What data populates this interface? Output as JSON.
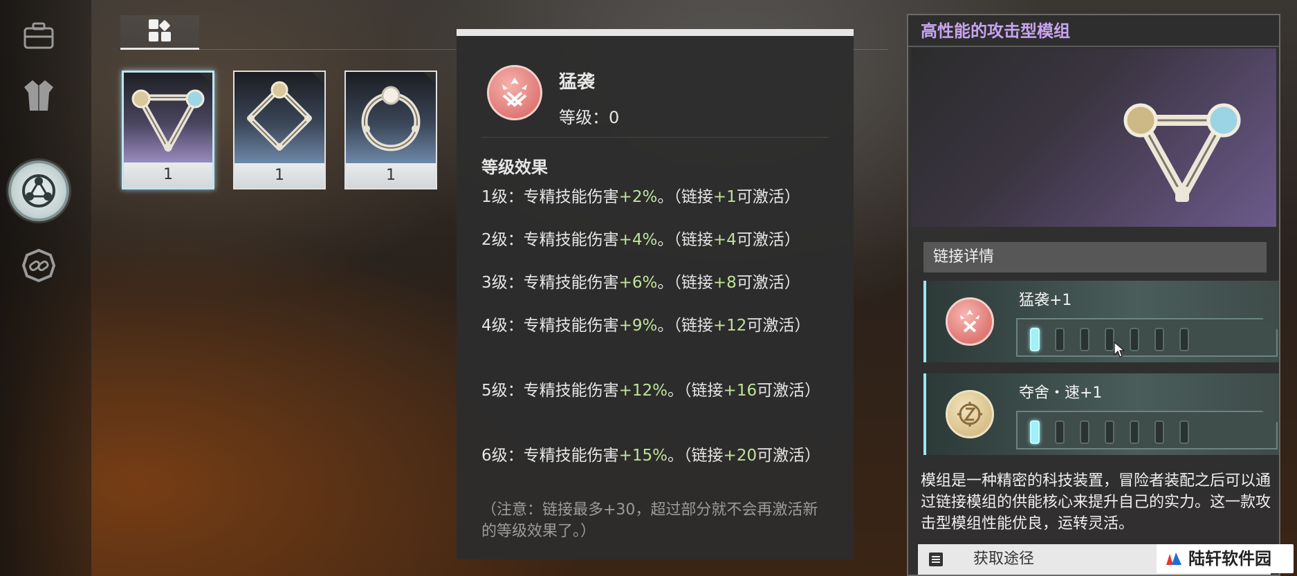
{
  "rail": {
    "items": [
      {
        "icon": "briefcase-icon"
      },
      {
        "icon": "outfit-icon"
      },
      {
        "icon": "module-icon",
        "active": true
      },
      {
        "icon": "link-chain-icon"
      }
    ]
  },
  "tab": {
    "icon": "grid-icon"
  },
  "cards": [
    {
      "shape": "triangle",
      "count": "1",
      "selected": true,
      "color": "#8f7fb0"
    },
    {
      "shape": "diamond",
      "count": "1",
      "selected": false,
      "color": "#5d7290"
    },
    {
      "shape": "ring",
      "count": "1",
      "selected": false,
      "color": "#5d7290"
    }
  ],
  "tooltip": {
    "name": "猛袭",
    "level": "等级：0",
    "section": "等级效果",
    "effects": [
      {
        "prefix": "1级：专精技能伤害",
        "value": "+2%",
        "mid": "。（链接",
        "link": "+1",
        "suffix": "可激活）"
      },
      {
        "prefix": "2级：专精技能伤害",
        "value": "+4%",
        "mid": "。（链接",
        "link": "+4",
        "suffix": "可激活）"
      },
      {
        "prefix": "3级：专精技能伤害",
        "value": "+6%",
        "mid": "。（链接",
        "link": "+8",
        "suffix": "可激活）"
      },
      {
        "prefix": "4级：专精技能伤害",
        "value": "+9%",
        "mid": "。（链接",
        "link": "+12",
        "suffix": "可激活）"
      },
      {
        "prefix": "5级：专精技能伤害",
        "value": "+12%",
        "mid": "。（链接",
        "link": "+16",
        "suffix": "可激活）"
      },
      {
        "prefix": "6级：专精技能伤害",
        "value": "+15%",
        "mid": "。（链接",
        "link": "+20",
        "suffix": "可激活）"
      }
    ],
    "note": "（注意：链接最多+30，超过部分就不会再激活新的等级效果了。）"
  },
  "panel": {
    "title": "高性能的攻击型模组",
    "section": "链接详情",
    "links": [
      {
        "label": "猛袭+1",
        "icon": "assault-icon",
        "filled": 1,
        "total": 7
      },
      {
        "label": "夺舍・速+1",
        "icon": "possession-speed-icon",
        "filled": 1,
        "total": 7
      }
    ],
    "description": "模组是一种精密的科技装置，冒险者装配之后可以通过链接模组的供能核心来提升自己的实力。这一款攻击型模组性能优良，运转灵活。",
    "obtain": "获取途径"
  },
  "watermark": "陆轩软件园"
}
